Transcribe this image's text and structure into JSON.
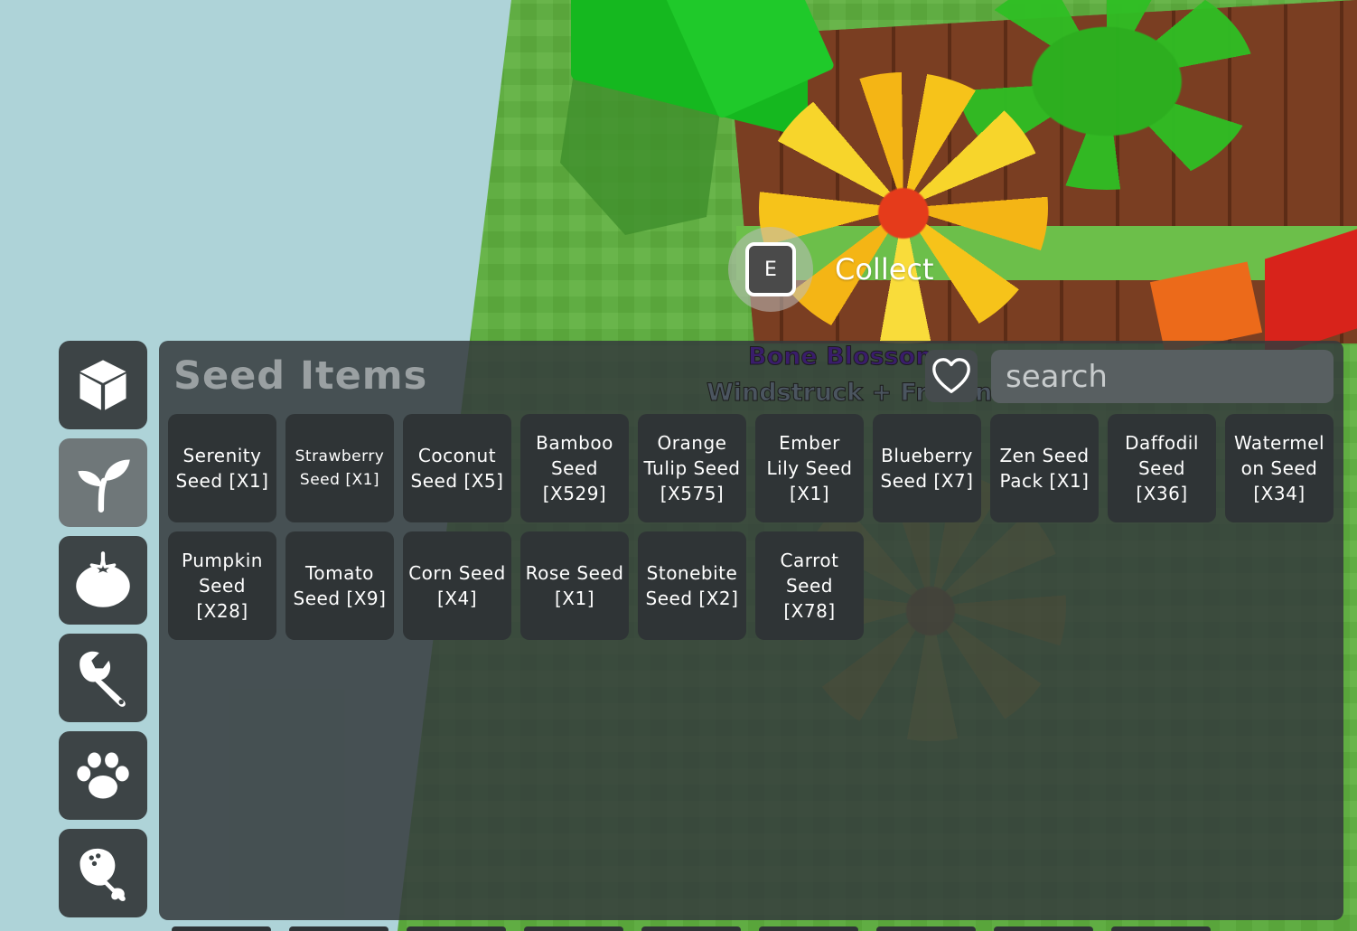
{
  "prompt": {
    "key": "E",
    "action": "Collect"
  },
  "sidebar": {
    "categories": [
      {
        "name": "Crates",
        "icon": "cube-icon"
      },
      {
        "name": "Seeds",
        "icon": "sprout-icon",
        "active": true
      },
      {
        "name": "Produce",
        "icon": "tomato-icon"
      },
      {
        "name": "Gear",
        "icon": "wrench-icon"
      },
      {
        "name": "Pets",
        "icon": "paw-icon"
      },
      {
        "name": "Food",
        "icon": "drumstick-icon"
      }
    ]
  },
  "panel": {
    "title": "Seed Items",
    "world_label_1": "Bone Blossom",
    "world_label_2": "Windstruck + Frozen",
    "favorite_icon": "heart-outline-icon",
    "search_placeholder": "search"
  },
  "items": [
    {
      "label": "Serenity\nSeed [X1]"
    },
    {
      "label": "Strawberry\nSeed [X1]",
      "small": true
    },
    {
      "label": "Coconut\nSeed [X5]"
    },
    {
      "label": "Bamboo\nSeed\n[X529]"
    },
    {
      "label": "Orange\nTulip Seed\n[X575]"
    },
    {
      "label": "Ember\nLily Seed\n[X1]"
    },
    {
      "label": "Blueberry\nSeed [X7]"
    },
    {
      "label": "Zen Seed\nPack [X1]"
    },
    {
      "label": "Daffodil\nSeed\n[X36]"
    },
    {
      "label": "Watermel\non Seed\n[X34]"
    },
    {
      "label": "Pumpkin\nSeed\n[X28]"
    },
    {
      "label": "Tomato\nSeed [X9]"
    },
    {
      "label": "Corn Seed\n[X4]"
    },
    {
      "label": "Rose Seed\n[X1]"
    },
    {
      "label": "Stonebite\nSeed [X2]"
    },
    {
      "label": "Carrot\nSeed\n[X78]"
    }
  ],
  "colors": {
    "panel_bg": "#343a3c",
    "slot_bg": "#2f3436",
    "active_category": "#6f7779",
    "text": "#ffffff"
  }
}
